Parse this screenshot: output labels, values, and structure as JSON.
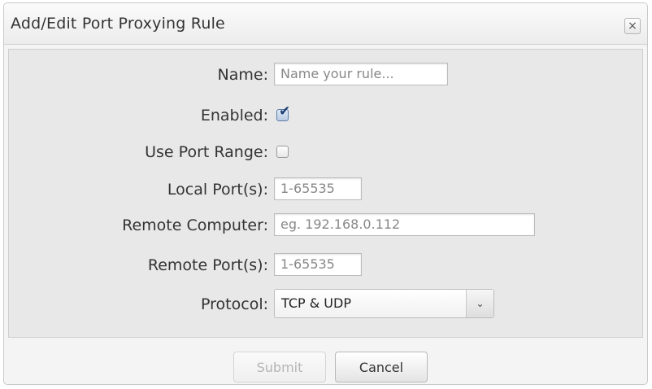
{
  "dialog": {
    "title": "Add/Edit Port Proxying Rule",
    "close_label": "×"
  },
  "form": {
    "name": {
      "label": "Name:",
      "placeholder": "Name your rule..."
    },
    "enabled": {
      "label": "Enabled:",
      "checked": true,
      "check_glyph": "✔"
    },
    "use_port_range": {
      "label": "Use Port Range:",
      "checked": false
    },
    "local_ports": {
      "label": "Local Port(s):",
      "placeholder": "1-65535"
    },
    "remote_computer": {
      "label": "Remote Computer:",
      "placeholder": "eg. 192.168.0.112"
    },
    "remote_ports": {
      "label": "Remote Port(s):",
      "placeholder": "1-65535"
    },
    "protocol": {
      "label": "Protocol:",
      "value": "TCP & UDP",
      "arrow": "⌄"
    }
  },
  "footer": {
    "submit_label": "Submit",
    "cancel_label": "Cancel"
  },
  "icons": {
    "close": "close-icon",
    "checkmark": "checkmark-icon",
    "dropdown": "chevron-down-icon"
  }
}
